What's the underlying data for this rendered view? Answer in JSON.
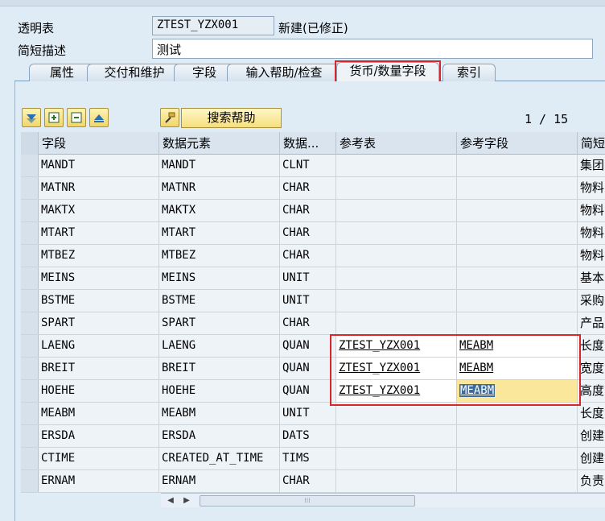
{
  "header": {
    "table_label": "透明表",
    "table_name": "ZTEST_YZX001",
    "table_status": "新建(已修正)",
    "desc_label": "简短描述",
    "desc_value": "测试"
  },
  "tabs": [
    {
      "label": "属性"
    },
    {
      "label": "交付和维护"
    },
    {
      "label": "字段"
    },
    {
      "label": "输入帮助/检查"
    },
    {
      "label": "货币/数量字段",
      "active": true
    },
    {
      "label": "索引"
    }
  ],
  "toolbar": {
    "search_help_label": "搜索帮助",
    "page_indicator": "1 / 15"
  },
  "columns": [
    "字段",
    "数据元素",
    "数据...",
    "参考表",
    "参考字段",
    "简短"
  ],
  "rows": [
    {
      "field": "MANDT",
      "element": "MANDT",
      "type": "CLNT",
      "ref_table": "",
      "ref_field": "",
      "desc": "集团"
    },
    {
      "field": "MATNR",
      "element": "MATNR",
      "type": "CHAR",
      "ref_table": "",
      "ref_field": "",
      "desc": "物料"
    },
    {
      "field": "MAKTX",
      "element": "MAKTX",
      "type": "CHAR",
      "ref_table": "",
      "ref_field": "",
      "desc": "物料"
    },
    {
      "field": "MTART",
      "element": "MTART",
      "type": "CHAR",
      "ref_table": "",
      "ref_field": "",
      "desc": "物料"
    },
    {
      "field": "MTBEZ",
      "element": "MTBEZ",
      "type": "CHAR",
      "ref_table": "",
      "ref_field": "",
      "desc": "物料"
    },
    {
      "field": "MEINS",
      "element": "MEINS",
      "type": "UNIT",
      "ref_table": "",
      "ref_field": "",
      "desc": "基本"
    },
    {
      "field": "BSTME",
      "element": "BSTME",
      "type": "UNIT",
      "ref_table": "",
      "ref_field": "",
      "desc": "采购"
    },
    {
      "field": "SPART",
      "element": "SPART",
      "type": "CHAR",
      "ref_table": "",
      "ref_field": "",
      "desc": "产品"
    },
    {
      "field": "LAENG",
      "element": "LAENG",
      "type": "QUAN",
      "ref_table": "ZTEST_YZX001",
      "ref_field": "MEABM",
      "desc": "长度"
    },
    {
      "field": "BREIT",
      "element": "BREIT",
      "type": "QUAN",
      "ref_table": "ZTEST_YZX001",
      "ref_field": "MEABM",
      "desc": "宽度"
    },
    {
      "field": "HOEHE",
      "element": "HOEHE",
      "type": "QUAN",
      "ref_table": "ZTEST_YZX001",
      "ref_field": "MEABM",
      "desc": "高度"
    },
    {
      "field": "MEABM",
      "element": "MEABM",
      "type": "UNIT",
      "ref_table": "",
      "ref_field": "",
      "desc": "长度"
    },
    {
      "field": "ERSDA",
      "element": "ERSDA",
      "type": "DATS",
      "ref_table": "",
      "ref_field": "",
      "desc": "创建"
    },
    {
      "field": "CTIME",
      "element": "CREATED_AT_TIME",
      "type": "TIMS",
      "ref_table": "",
      "ref_field": "",
      "desc": "创建"
    },
    {
      "field": "ERNAM",
      "element": "ERNAM",
      "type": "CHAR",
      "ref_table": "",
      "ref_field": "",
      "desc": "负责"
    }
  ],
  "icons": [
    "filter-icon",
    "insert-row-icon",
    "delete-row-icon",
    "sort-icon",
    "search-help-icon"
  ],
  "colors": {
    "highlight_border": "#d9262b",
    "focus_cell": "#fbe79b",
    "selected_text_bg": "#3c6a99"
  }
}
